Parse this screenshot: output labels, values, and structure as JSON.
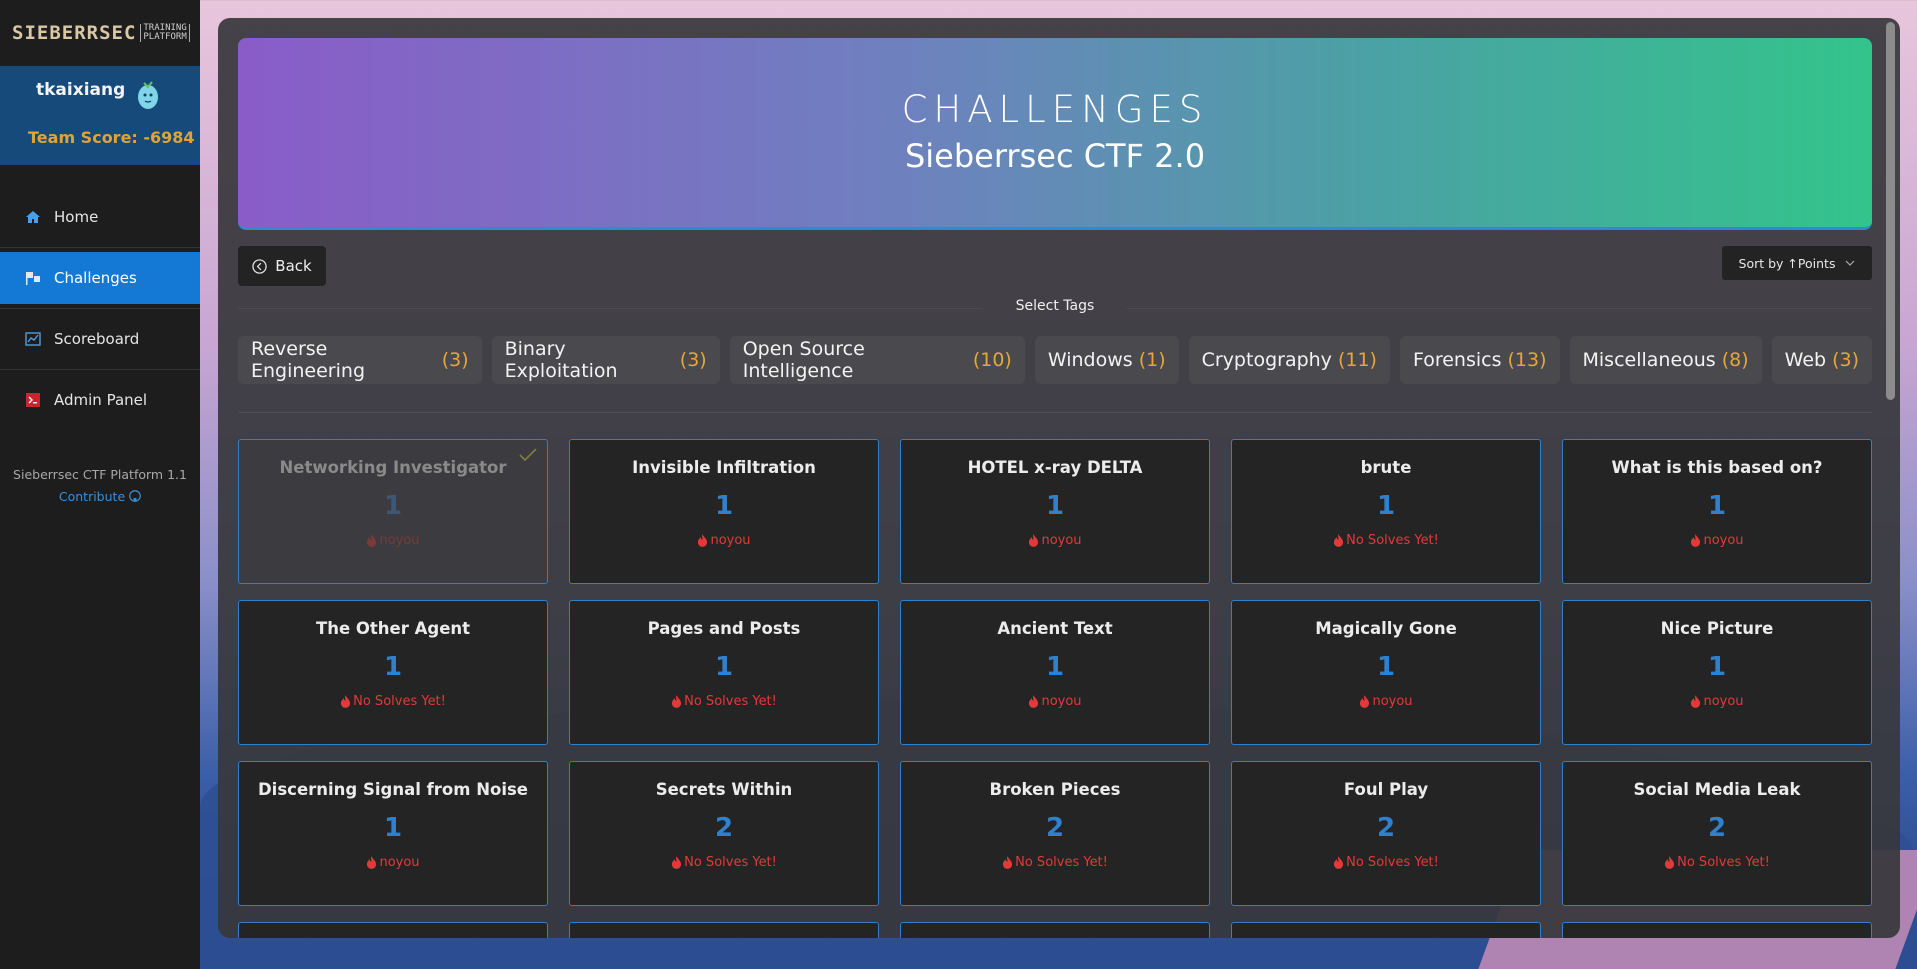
{
  "brand": {
    "logo_main": "SIEBERRSEC",
    "logo_sub_1": "TRAINING",
    "logo_sub_2": "PLATFORM"
  },
  "user": {
    "name": "tkaixiang",
    "team_score": "Team Score: -6984"
  },
  "nav": {
    "items": [
      {
        "label": "Home",
        "icon": "home-icon"
      },
      {
        "label": "Challenges",
        "icon": "flag-icon",
        "active": true
      },
      {
        "label": "Scoreboard",
        "icon": "chart-icon"
      },
      {
        "label": "Admin Panel",
        "icon": "terminal-icon"
      }
    ]
  },
  "platform": {
    "version": "Sieberrsec CTF Platform 1.1",
    "contribute": "Contribute"
  },
  "banner": {
    "title": "CHALLENGES",
    "subtitle": "Sieberrsec CTF 2.0"
  },
  "controls": {
    "back_label": "Back",
    "sort_label": "Sort by ↑Points"
  },
  "tags": {
    "heading": "Select Tags",
    "items": [
      {
        "name": "Reverse Engineering",
        "count": "(3)"
      },
      {
        "name": "Binary Exploitation",
        "count": "(3)"
      },
      {
        "name": "Open Source Intelligence",
        "count": "(10)"
      },
      {
        "name": "Windows",
        "count": "(1)"
      },
      {
        "name": "Cryptography",
        "count": "(11)"
      },
      {
        "name": "Forensics",
        "count": "(13)"
      },
      {
        "name": "Miscellaneous",
        "count": "(8)"
      },
      {
        "name": "Web",
        "count": "(3)"
      }
    ]
  },
  "challenges": [
    {
      "title": "Networking Investigator",
      "points": "1",
      "solver": "noyou",
      "solved": true
    },
    {
      "title": "Invisible Infiltration",
      "points": "1",
      "solver": "noyou"
    },
    {
      "title": "HOTEL x-ray DELTA",
      "points": "1",
      "solver": "noyou"
    },
    {
      "title": "brute",
      "points": "1",
      "solver": "No Solves Yet!"
    },
    {
      "title": "What is this based on?",
      "points": "1",
      "solver": "noyou"
    },
    {
      "title": "The Other Agent",
      "points": "1",
      "solver": "No Solves Yet!"
    },
    {
      "title": "Pages and Posts",
      "points": "1",
      "solver": "No Solves Yet!"
    },
    {
      "title": "Ancient Text",
      "points": "1",
      "solver": "noyou"
    },
    {
      "title": "Magically Gone",
      "points": "1",
      "solver": "noyou"
    },
    {
      "title": "Nice Picture",
      "points": "1",
      "solver": "noyou"
    },
    {
      "title": "Discerning Signal from Noise",
      "points": "1",
      "solver": "noyou"
    },
    {
      "title": "Secrets Within",
      "points": "2",
      "solver": "No Solves Yet!"
    },
    {
      "title": "Broken Pieces",
      "points": "2",
      "solver": "No Solves Yet!"
    },
    {
      "title": "Foul Play",
      "points": "2",
      "solver": "No Solves Yet!"
    },
    {
      "title": "Social Media Leak",
      "points": "2",
      "solver": "No Solves Yet!"
    }
  ],
  "colors": {
    "accent": "#1479d4",
    "points": "#2f80cd",
    "solver": "#e23a3a",
    "tag_count": "#e5a63a",
    "score": "#e0a435"
  }
}
